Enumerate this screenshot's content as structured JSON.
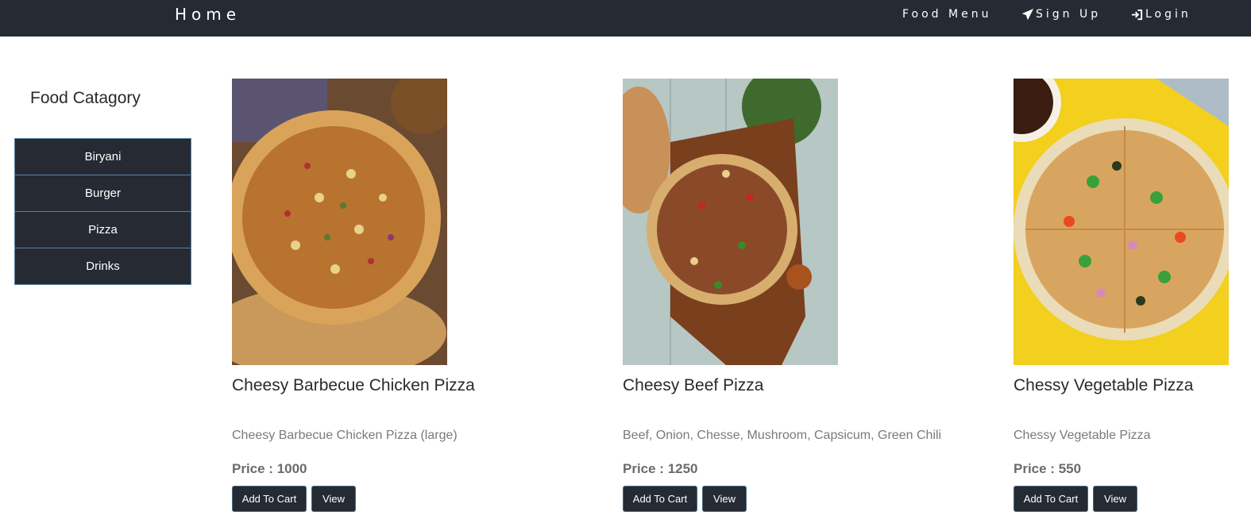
{
  "navbar": {
    "brand": "Home",
    "links": {
      "food_menu": "Food Menu",
      "sign_up": "Sign Up",
      "login": "Login"
    },
    "icons": {
      "sign_up": "paper-plane-icon",
      "login": "sign-in-icon"
    },
    "background": "#262b33"
  },
  "sidebar": {
    "title": "Food Catagory",
    "items": [
      {
        "label": "Biryani"
      },
      {
        "label": "Burger"
      },
      {
        "label": "Pizza"
      },
      {
        "label": "Drinks"
      }
    ]
  },
  "products": [
    {
      "title": "Cheesy Barbecue Chicken Pizza",
      "description": "Cheesy Barbecue Chicken Pizza (large)",
      "price": "Price : 1000",
      "add_to_cart": "Add To Cart",
      "view": "View"
    },
    {
      "title": "Cheesy Beef Pizza",
      "description": "Beef, Onion, Chesse, Mushroom, Capsicum, Green Chili",
      "price": "Price : 1250",
      "add_to_cart": "Add To Cart",
      "view": "View"
    },
    {
      "title": "Chessy Vegetable Pizza",
      "description": "Chessy Vegetable Pizza",
      "price": "Price : 550",
      "add_to_cart": "Add To Cart",
      "view": "View"
    }
  ]
}
